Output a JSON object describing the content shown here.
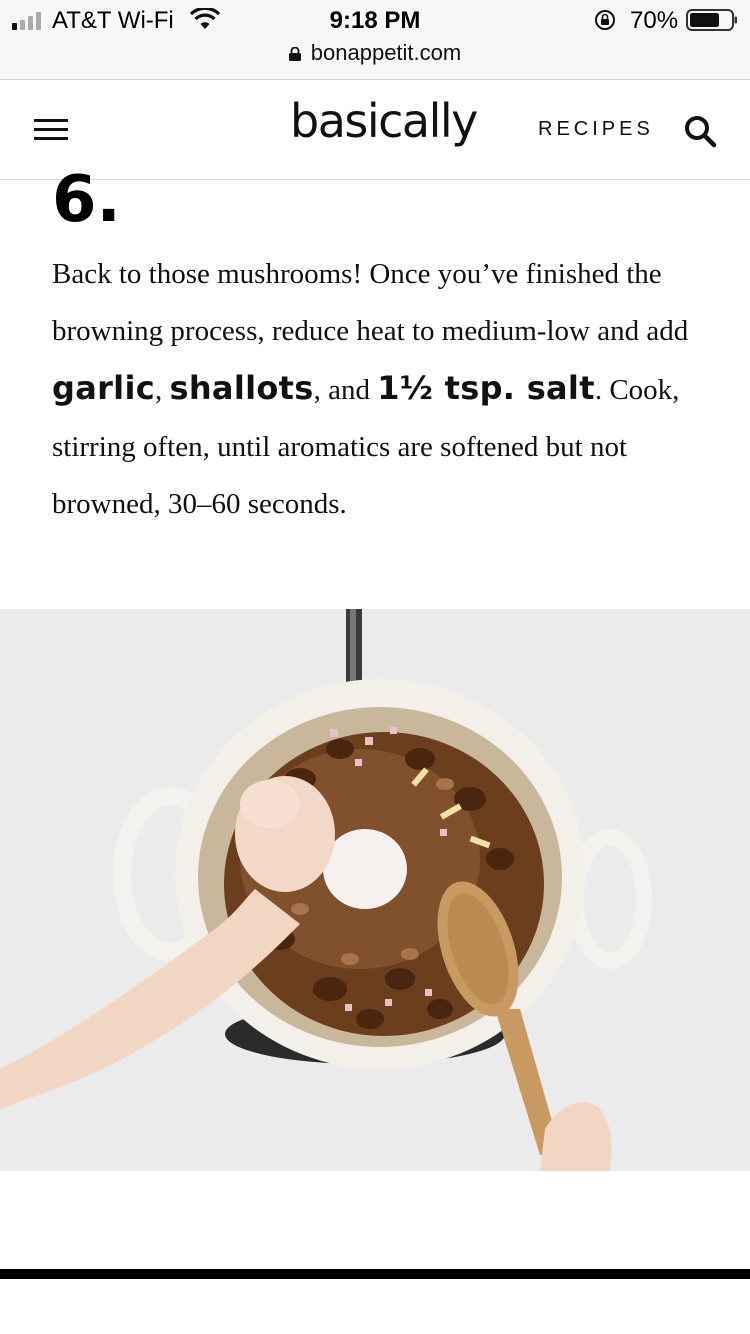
{
  "status_bar": {
    "carrier": "AT&T Wi-Fi",
    "time": "9:18 PM",
    "battery_percent": "70%",
    "url": "bonappetit.com"
  },
  "header": {
    "logo": "basically",
    "nav_recipes": "RECIPES"
  },
  "step": {
    "number": "6.",
    "text_1": "Back to those mushrooms! Once you’ve finished the browning process, reduce heat to medium-low and add ",
    "ing_1": "garlic",
    "text_2": ", ",
    "ing_2": "shallots",
    "text_3": ", and ",
    "ing_3": "1½ tsp. salt",
    "text_4": ". Cook, stirring often, until aromatics are softened but not browned, 30–60 seconds."
  },
  "colors": {
    "status_bg": "#f7f7f7",
    "text": "#111111",
    "divider": "#d9d9d9",
    "bottom_bar": "#000000"
  },
  "icons": {
    "menu": "menu-icon",
    "search": "search-icon",
    "wifi": "wifi-icon",
    "lock": "lock-icon",
    "battery": "battery-icon"
  }
}
